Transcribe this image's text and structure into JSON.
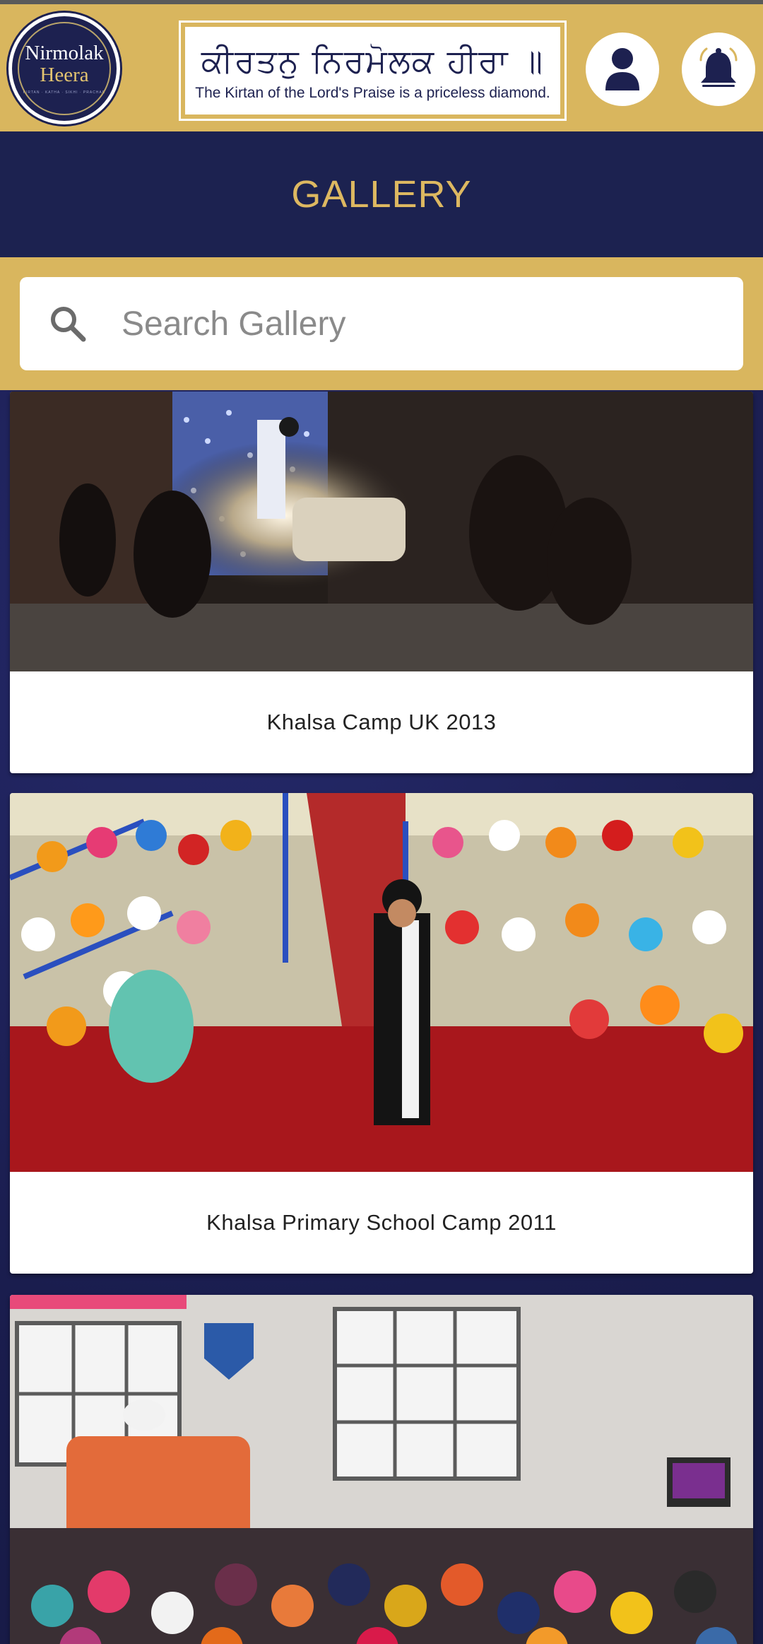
{
  "header": {
    "logo": {
      "line1": "Nirmolak",
      "line2": "Heera",
      "tagline": "KIRTAN · KATHA · SIKHI · PRACHAR"
    },
    "banner": {
      "gurmukhi": "ਕੀਰਤਨੁ ਨਿਰਮੋਲਕ ਹੀਰਾ ॥",
      "subtitle": "The Kirtan of the Lord's Praise is a priceless diamond."
    },
    "icons": {
      "user": "user-icon",
      "bell": "bell-icon"
    }
  },
  "page": {
    "title": "GALLERY"
  },
  "search": {
    "placeholder": "Search Gallery",
    "value": "",
    "icon": "search-icon"
  },
  "gallery": {
    "items": [
      {
        "caption": "Khalsa Camp UK 2013"
      },
      {
        "caption": "Khalsa Primary School Camp 2011"
      },
      {
        "caption": ""
      }
    ]
  },
  "colors": {
    "gold": "#d9b65e",
    "navy": "#1c2250",
    "title_gold": "#ddb861",
    "card": "#ffffff"
  }
}
